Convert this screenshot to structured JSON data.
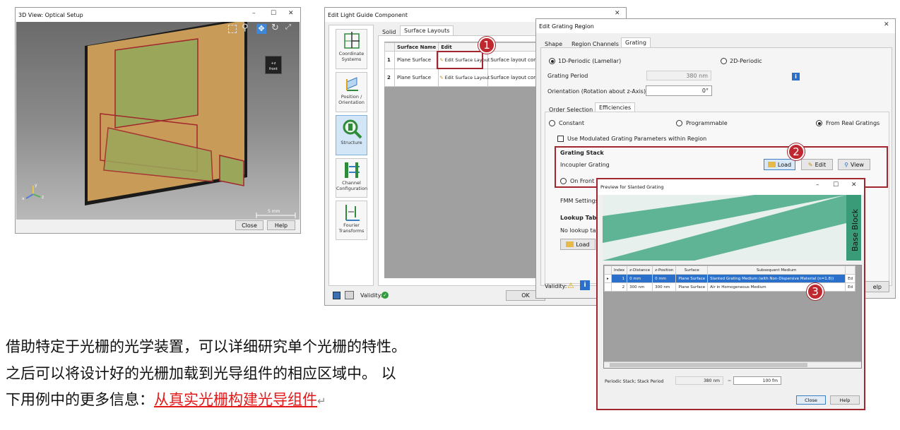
{
  "view3d": {
    "title": "3D View: Optical Setup",
    "scale_label": "5 mm",
    "close": "Close",
    "help": "Help",
    "cube_face": "+z\nfront"
  },
  "lgc": {
    "title": "Edit Light Guide Component",
    "nav": [
      "Coordinate Systems",
      "Position / Orientation",
      "Structure",
      "Channel Configuration",
      "Fourier Transforms"
    ],
    "tabs": [
      "Solid",
      "Surface Layouts"
    ],
    "table_headers": [
      "Surface Name",
      "Edit"
    ],
    "rows": [
      {
        "index": "1",
        "name": "Plane Surface",
        "edit": "Edit Surface Layout",
        "desc": "Surface layout contain"
      },
      {
        "index": "2",
        "name": "Plane Surface",
        "edit": "Edit Surface Layout",
        "desc": "Surface layout contain"
      }
    ],
    "validity": "Validity:",
    "ok": "OK"
  },
  "egr": {
    "title": "Edit Grating Region",
    "tabs": [
      "Shape",
      "Region Channels",
      "Grating"
    ],
    "radio_1d": "1D-Periodic (Lamellar)",
    "radio_2d": "2D-Periodic",
    "period_label": "Grating Period",
    "period_value": "380 nm",
    "orientation_label": "Orientation (Rotation about z-Axis)",
    "orientation_value": "0°",
    "subtabs": [
      "Order Selection",
      "Efficiencies"
    ],
    "eff_constant": "Constant",
    "eff_programmable": "Programmable",
    "eff_real": "From Real Gratings",
    "use_modulated": "Use Modulated Grating Parameters within Region",
    "stack_title": "Grating Stack",
    "incoupler": "Incoupler Grating",
    "load": "Load",
    "edit": "Edit",
    "view": "View",
    "on_front": "On Front S",
    "fmm": "FMM Settings",
    "lookup_title": "Lookup Table",
    "lookup_text": "No lookup ta",
    "lookup_load": "Load",
    "validity": "Validity:",
    "help_partial": "elp"
  },
  "preview": {
    "title": "Preview for Slanted Grating",
    "base_block": "Base Block",
    "headers": [
      "Index",
      "z-Distance",
      "z-Position",
      "Surface",
      "Subsequent Medium"
    ],
    "rows": [
      {
        "index": "1",
        "zdist": "0 mm",
        "zpos": "0 mm",
        "surface": "Plane Surface",
        "medium": "Slanted Grating Medium (with Non-Dispersive Material (n=1.8))",
        "end": "Ed"
      },
      {
        "index": "2",
        "zdist": "300 nm",
        "zpos": "300 nm",
        "surface": "Plane Surface",
        "medium": "Air in Homogeneous Medium",
        "end": "Ed"
      }
    ],
    "period_label": "Periodic Stack; Stack Period",
    "period_value": "380 nm",
    "eq": "=",
    "period_value2": "100 fm",
    "close": "Close",
    "help": "Help"
  },
  "badges": [
    "1",
    "2",
    "3"
  ],
  "caption": {
    "line1": "借助特定于光栅的光学装置，可以详细研究单个光栅的特性。",
    "line2": "之后可以将设计好的光栅加载到光导组件的相应区域中。 以",
    "line3_prefix": "下用例中的更多信息：",
    "line3_link": "从真实光栅构建光导组件",
    "return_mark": "↵"
  },
  "colors": {
    "gold": "#c89c58",
    "green_region": "#9aa75a",
    "highlight_red": "#a1262d",
    "grating_teal": "#5fb496"
  }
}
